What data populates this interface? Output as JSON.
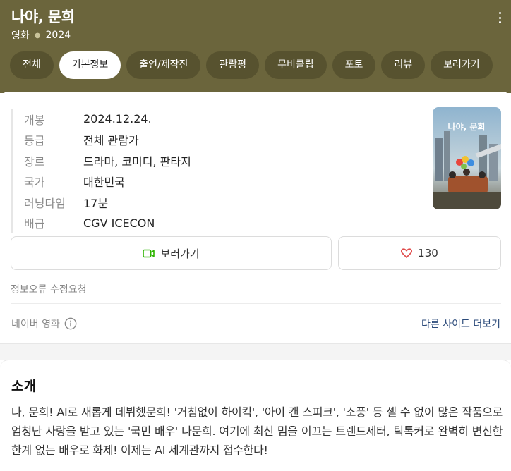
{
  "header": {
    "title": "나야, 문희",
    "category": "영화",
    "year": "2024",
    "colors": {
      "background": "#6b653c",
      "tab_background": "#57522f"
    }
  },
  "tabs": [
    {
      "label": "전체",
      "active": false
    },
    {
      "label": "기본정보",
      "active": true
    },
    {
      "label": "출연/제작진",
      "active": false
    },
    {
      "label": "관람평",
      "active": false
    },
    {
      "label": "무비클립",
      "active": false
    },
    {
      "label": "포토",
      "active": false
    },
    {
      "label": "리뷰",
      "active": false
    },
    {
      "label": "보러가기",
      "active": false
    }
  ],
  "info": [
    {
      "key": "개봉",
      "value": "2024.12.24."
    },
    {
      "key": "등급",
      "value": "전체 관람가"
    },
    {
      "key": "장르",
      "value": "드라마, 코미디, 판타지"
    },
    {
      "key": "국가",
      "value": "대한민국"
    },
    {
      "key": "러닝타임",
      "value": "17분"
    },
    {
      "key": "배급",
      "value": "CGV ICECON"
    }
  ],
  "poster": {
    "title_text": "나야, 문희"
  },
  "actions": {
    "watch_label": "보러가기",
    "like_count": "130",
    "icons": {
      "watch": "video-camera-icon",
      "like": "heart-icon"
    },
    "colors": {
      "watch_icon": "#2db400",
      "like_icon": "#e04b4b"
    }
  },
  "report_link": "정보오류 수정요청",
  "source": {
    "label": "네이버 영화",
    "more_sites": "다른 사이트 더보기"
  },
  "intro": {
    "title": "소개",
    "text": "나, 문희! AI로 새롭게 데뷔했문희! '거침없이 하이킥', '아이 캔 스피크', '소풍' 등 셀 수 없이 많은 작품으로 엄청난 사랑을 받고 있는 '국민 배우' 나문희. 여기에 최신 밈을 이끄는 트렌드세터, 틱톡커로 완벽히 변신한 한계 없는 배우로 화제! 이제는 AI 세계관까지 접수한다!"
  }
}
